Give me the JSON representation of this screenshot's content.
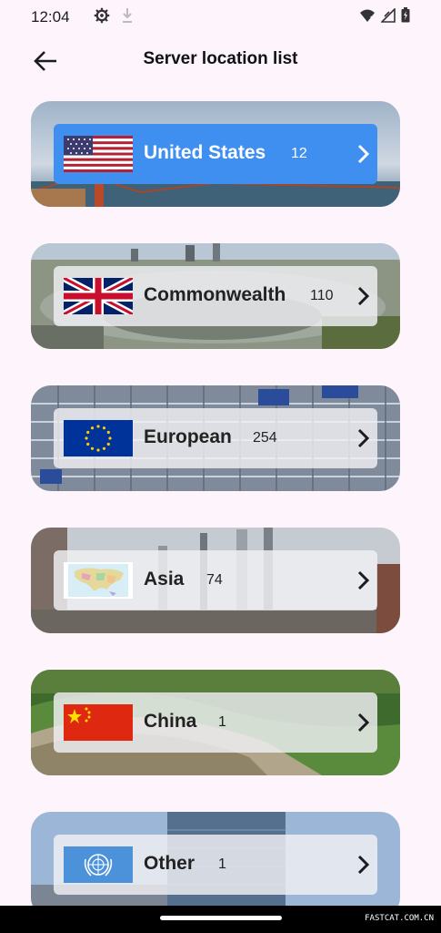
{
  "status": {
    "time": "12:04"
  },
  "header": {
    "title": "Server location list"
  },
  "locations": [
    {
      "name": "United States",
      "count": "12",
      "selected": true
    },
    {
      "name": "Commonwealth",
      "count": "110",
      "selected": false
    },
    {
      "name": "European",
      "count": "254",
      "selected": false
    },
    {
      "name": "Asia",
      "count": "74",
      "selected": false
    },
    {
      "name": "China",
      "count": "1",
      "selected": false
    },
    {
      "name": "Other",
      "count": "1",
      "selected": false
    }
  ],
  "colors": {
    "background": "#fdf5fb",
    "selected_row": "#3e8ff0",
    "row_overlay": "#f0f0f4"
  },
  "icons": {
    "back": "arrow-left-icon",
    "settings": "gear-icon",
    "download": "download-icon",
    "wifi": "wifi-icon",
    "signal": "signal-icon",
    "battery": "battery-icon",
    "chevron": "chevron-right-icon"
  },
  "watermark": "FASTCAT.COM.CN"
}
